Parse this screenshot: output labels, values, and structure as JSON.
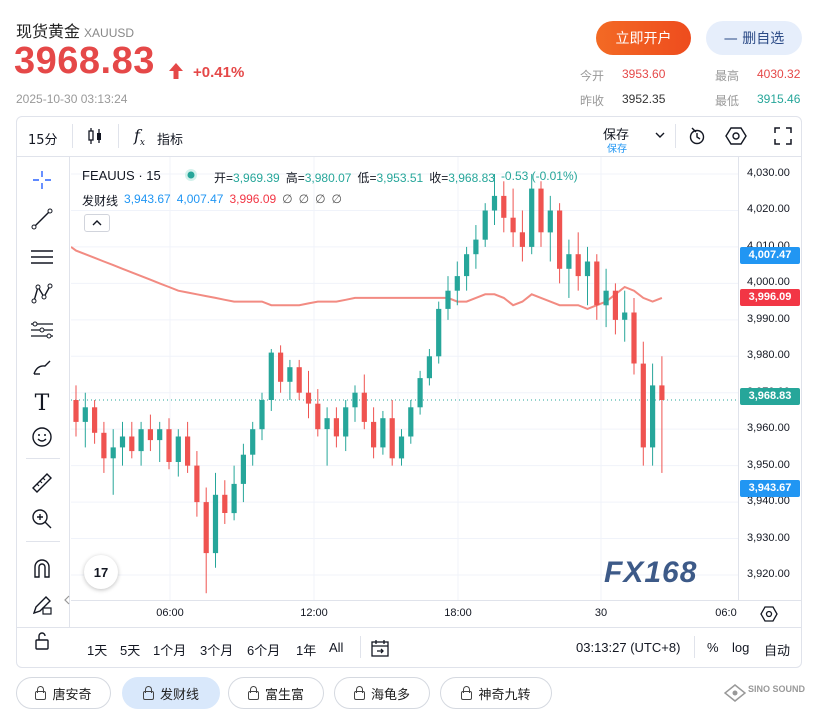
{
  "header": {
    "title": "现货黄金",
    "symbol": "XAUUSD",
    "price": "3968.83",
    "change_pct": "+0.41%",
    "datetime": "2025-10-30 03:13:24",
    "open_account_label": "立即开户",
    "remove_watch_label": "— 删自选",
    "stats": [
      {
        "label": "今开",
        "value": "3953.60"
      },
      {
        "label": "最高",
        "value": "4030.32"
      },
      {
        "label": "昨收",
        "value": "3952.35"
      },
      {
        "label": "最低",
        "value": "3915.46"
      }
    ],
    "colors": {
      "up": "#e54848",
      "accent": "#f0591f"
    }
  },
  "toolbar": {
    "interval": "15分",
    "indicators_label": "指标",
    "save_label": "保存",
    "save_sub_label": "保存"
  },
  "legend": {
    "symbol_interval": "FEAUUS · 15",
    "ohlc": [
      {
        "label": "开=",
        "value": "3,969.39"
      },
      {
        "label": "高=",
        "value": "3,980.07"
      },
      {
        "label": "低=",
        "value": "3,953.51"
      },
      {
        "label": "收=",
        "value": "3,968.83"
      }
    ],
    "change": "-0.53 (-0.01%)",
    "indicator_name": "发财线",
    "indicator_values": [
      "3,943.67",
      "4,007.47",
      "3,996.09"
    ],
    "eye_icons": [
      "∅",
      "∅",
      "∅",
      "∅"
    ]
  },
  "price_axis": {
    "ticks": [
      "4,030.00",
      "4,020.00",
      "4,010.00",
      "4,000.00",
      "3,990.00",
      "3,980.00",
      "3,970.00",
      "3,960.00",
      "3,950.00",
      "3,940.00",
      "3,930.00",
      "3,920.00"
    ],
    "labels": [
      {
        "value": "4,007.47",
        "color": "#2196f3"
      },
      {
        "value": "3,996.09",
        "color": "#f23645"
      },
      {
        "value": "3,968.83",
        "color": "#26a69a"
      },
      {
        "value": "3,943.67",
        "color": "#2196f3"
      }
    ]
  },
  "time_axis": {
    "ticks": [
      "06:00",
      "12:00",
      "18:00",
      "30",
      "06:0"
    ]
  },
  "bottom_bar": {
    "ranges": [
      "1天",
      "5天",
      "1个月",
      "3个月",
      "6个月",
      "1年",
      "All"
    ],
    "clock": "03:13:27 (UTC+8)",
    "percent_label": "%",
    "log_label": "log",
    "auto_label": "自动"
  },
  "watermark": "FX168",
  "pills": [
    {
      "label": "唐安奇",
      "active": false
    },
    {
      "label": "发财线",
      "active": true
    },
    {
      "label": "富生富",
      "active": false
    },
    {
      "label": "海龟多",
      "active": false
    },
    {
      "label": "神奇九转",
      "active": false
    }
  ],
  "brand_badge": "SINO SOUND",
  "chart_data": {
    "type": "candlestick",
    "interval": "15",
    "ylim": [
      3912,
      4035
    ],
    "up_color": "#26a69a",
    "down_color": "#ef5350",
    "candles": [
      [
        3968,
        3972,
        3958,
        3962
      ],
      [
        3962,
        3970,
        3955,
        3966
      ],
      [
        3966,
        3968,
        3956,
        3959
      ],
      [
        3959,
        3962,
        3948,
        3952
      ],
      [
        3952,
        3960,
        3942,
        3955
      ],
      [
        3955,
        3962,
        3950,
        3958
      ],
      [
        3958,
        3962,
        3952,
        3954
      ],
      [
        3954,
        3962,
        3950,
        3960
      ],
      [
        3960,
        3964,
        3954,
        3957
      ],
      [
        3957,
        3962,
        3951,
        3960
      ],
      [
        3960,
        3963,
        3949,
        3951
      ],
      [
        3951,
        3960,
        3947,
        3958
      ],
      [
        3958,
        3962,
        3948,
        3950
      ],
      [
        3950,
        3954,
        3936,
        3940
      ],
      [
        3940,
        3944,
        3915,
        3926
      ],
      [
        3926,
        3948,
        3922,
        3942
      ],
      [
        3942,
        3946,
        3934,
        3937
      ],
      [
        3937,
        3950,
        3935,
        3945
      ],
      [
        3945,
        3956,
        3940,
        3953
      ],
      [
        3953,
        3962,
        3950,
        3960
      ],
      [
        3960,
        3970,
        3957,
        3968
      ],
      [
        3968,
        3982,
        3965,
        3981
      ],
      [
        3981,
        3983,
        3970,
        3973
      ],
      [
        3973,
        3979,
        3968,
        3977
      ],
      [
        3977,
        3979,
        3968,
        3970
      ],
      [
        3970,
        3976,
        3963,
        3967
      ],
      [
        3967,
        3971,
        3958,
        3960
      ],
      [
        3960,
        3966,
        3950,
        3963
      ],
      [
        3963,
        3966,
        3955,
        3958
      ],
      [
        3958,
        3968,
        3954,
        3966
      ],
      [
        3966,
        3972,
        3962,
        3970
      ],
      [
        3970,
        3975,
        3960,
        3962
      ],
      [
        3962,
        3966,
        3952,
        3955
      ],
      [
        3955,
        3965,
        3953,
        3963
      ],
      [
        3963,
        3968,
        3950,
        3952
      ],
      [
        3952,
        3960,
        3950,
        3958
      ],
      [
        3958,
        3968,
        3956,
        3966
      ],
      [
        3966,
        3976,
        3964,
        3974
      ],
      [
        3974,
        3982,
        3972,
        3980
      ],
      [
        3980,
        3995,
        3978,
        3993
      ],
      [
        3993,
        4002,
        3990,
        3998
      ],
      [
        3998,
        4006,
        3994,
        4002
      ],
      [
        4002,
        4010,
        3998,
        4008
      ],
      [
        4008,
        4016,
        4004,
        4012
      ],
      [
        4012,
        4022,
        4010,
        4020
      ],
      [
        4020,
        4030,
        4016,
        4024
      ],
      [
        4024,
        4028,
        4014,
        4018
      ],
      [
        4018,
        4026,
        4010,
        4014
      ],
      [
        4014,
        4020,
        4006,
        4010
      ],
      [
        4010,
        4030,
        4008,
        4026
      ],
      [
        4026,
        4028,
        4010,
        4014
      ],
      [
        4014,
        4024,
        4006,
        4020
      ],
      [
        4020,
        4022,
        4000,
        4004
      ],
      [
        4004,
        4012,
        3996,
        4008
      ],
      [
        4008,
        4014,
        3998,
        4002
      ],
      [
        4002,
        4010,
        3994,
        4006
      ],
      [
        4006,
        4008,
        3990,
        3994
      ],
      [
        3994,
        4004,
        3988,
        3998
      ],
      [
        3998,
        4000,
        3986,
        3990
      ],
      [
        3990,
        3998,
        3984,
        3992
      ],
      [
        3992,
        3996,
        3975,
        3978
      ],
      [
        3978,
        3984,
        3950,
        3955
      ],
      [
        3955,
        3978,
        3950,
        3972
      ],
      [
        3972,
        3980,
        3948,
        3968
      ]
    ],
    "indicator_line": [
      4009,
      4008,
      4007,
      4006,
      4005,
      4004,
      4003,
      4002,
      4001,
      4000,
      3999,
      3998,
      3997.5,
      3997,
      3996.5,
      3996,
      3995.5,
      3995,
      3995,
      3995,
      3995,
      3994,
      3994,
      3994,
      3994,
      3994.5,
      3995,
      3995,
      3995,
      3995.5,
      3996,
      3996,
      3996,
      3996,
      3996,
      3996,
      3996,
      3996,
      3996,
      3996,
      3996,
      3995,
      3995,
      3996,
      3997,
      3997,
      3996,
      3994,
      3995,
      3997,
      3996,
      3995,
      3994,
      3994,
      3994,
      3993,
      3994,
      3995,
      3997,
      3999,
      3998,
      3996,
      3995,
      3996
    ]
  }
}
